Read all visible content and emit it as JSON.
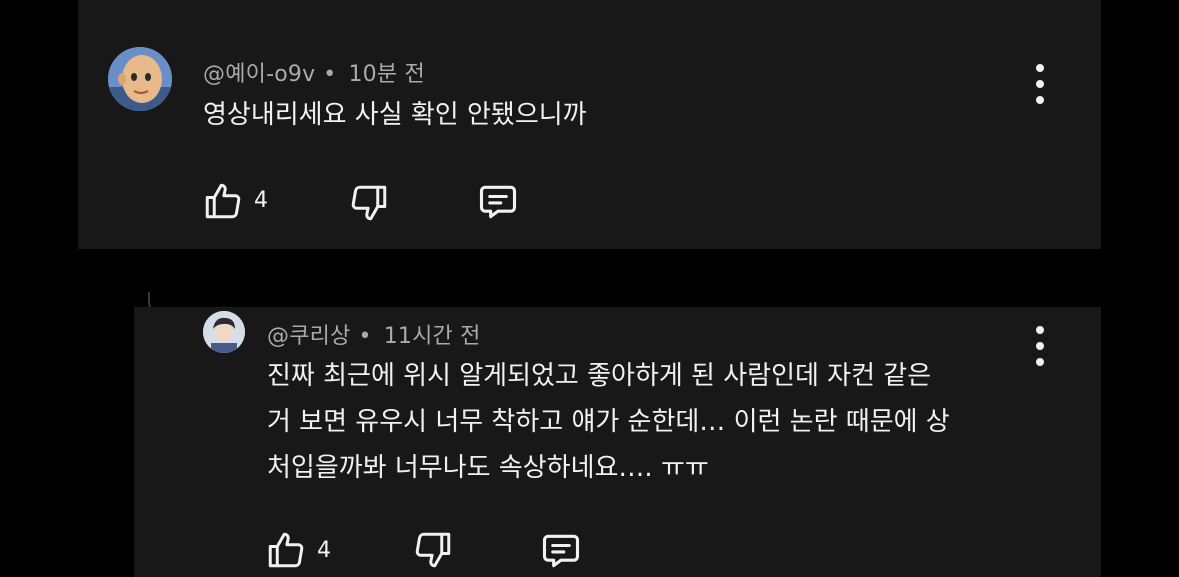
{
  "comments": [
    {
      "handle": "@예이-o9v",
      "separator": "•",
      "time": "10분 전",
      "lines": [
        "영상내리세요 사실 확인 안됐으니까"
      ],
      "likes": "4",
      "avatar_icon": "bald-character-avatar-icon"
    },
    {
      "handle": "@쿠리상",
      "separator": "•",
      "time": "11시간 전",
      "lines": [
        "진짜 최근에 위시 알게되었고 좋아하게 된 사람인데 자컨 같은",
        "거 보면 유우시 너무 착하고 얘가 순한데… 이런 논란 때문에 상",
        "처입을까봐 너무나도 속상하네요…. ㅠㅠ"
      ],
      "likes": "4",
      "avatar_icon": "person-photo-avatar-icon"
    }
  ],
  "colors": {
    "background": "#000000",
    "card": "#181818",
    "meta": "#aaaaaa",
    "text": "#f1f1f1"
  },
  "icons": [
    "thumbs-up-icon",
    "thumbs-down-icon",
    "reply-comment-icon",
    "more-vertical-icon"
  ]
}
